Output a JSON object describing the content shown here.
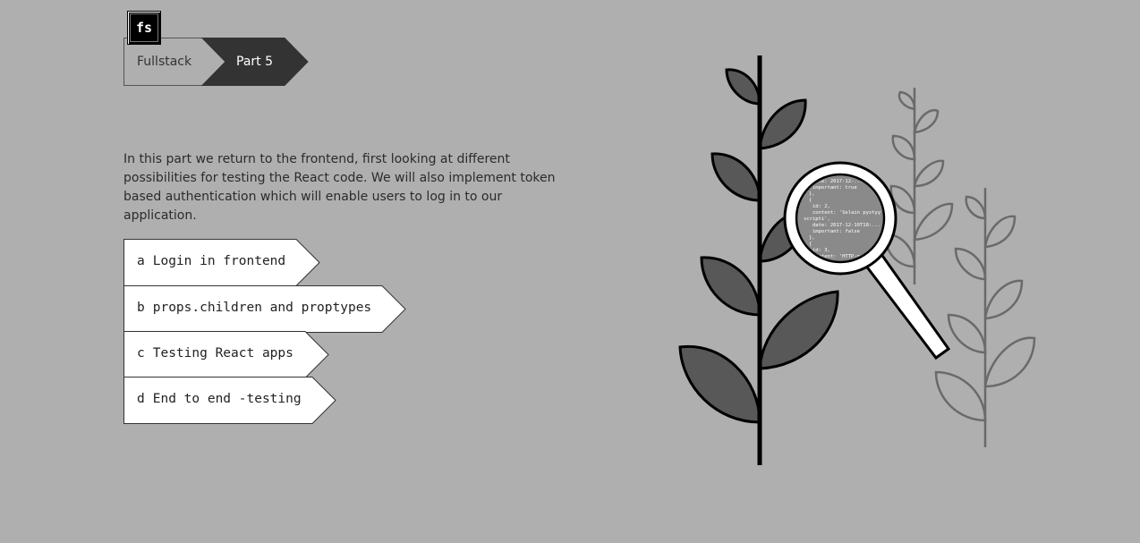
{
  "logo": {
    "text": "fs"
  },
  "breadcrumb": {
    "parent": "Fullstack",
    "current": "Part 5"
  },
  "intro": {
    "text": "In this part we return to the frontend, first looking at different possibilities for testing the React code. We will also implement token based authentication which will enable users to log in to our application."
  },
  "menu": {
    "items": [
      {
        "letter": "a",
        "label": "Login in frontend"
      },
      {
        "letter": "b",
        "label": "props.children and proptypes"
      },
      {
        "letter": "c",
        "label": "Testing React apps"
      },
      {
        "letter": "d",
        "label": "End to end -testing"
      }
    ]
  },
  "illustration": {
    "name": "plant-magnifier-illustration",
    "code_lines": [
      "date: 2017-12-...",
      "important: true",
      "},",
      "{",
      "id: 2,",
      "content: 'Selain pystyy",
      "scripti',",
      "date: 2017-12-10T18:...",
      "important: false",
      "},",
      "{",
      "id: 3,",
      "content: 'HTTP-p...",
      "date: ..."
    ]
  },
  "colors": {
    "background": "#afafaf",
    "dark": "#333333",
    "leaf_dark": "#585858",
    "white": "#ffffff"
  }
}
